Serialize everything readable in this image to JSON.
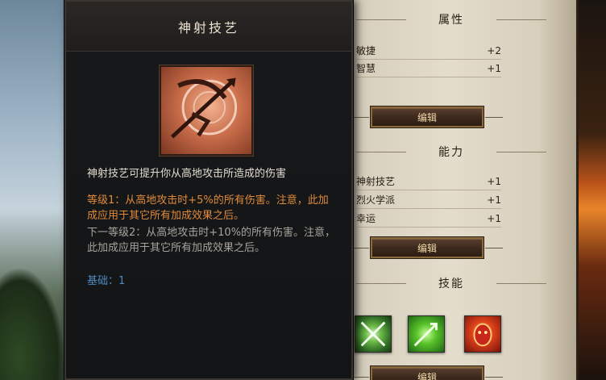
{
  "tooltip": {
    "title": "神射技艺",
    "icon": "archery-crossbow-icon",
    "description": "神射技艺可提升你从高地攻击所造成的伤害",
    "tier_current": "等级1：从高地攻击时+5%的所有伤害。注意，此加成应用于其它所有加成效果之后。",
    "tier_next": "下一等级2：从高地攻击时+10%的所有伤害。注意，此加成应用于其它所有加成效果之后。",
    "base": "基础：1",
    "colors": {
      "current_tier": "#e08a3a",
      "next_tier": "#a8a49c",
      "base": "#4f8ac0"
    }
  },
  "attributes": {
    "header": "属性",
    "rows": [
      {
        "name": "敏捷",
        "value": "+2"
      },
      {
        "name": "智慧",
        "value": "+1"
      }
    ],
    "edit_label": "编辑"
  },
  "abilities": {
    "header": "能力",
    "rows": [
      {
        "name": "神射技艺",
        "value": "+1"
      },
      {
        "name": "烈火学派",
        "value": "+1"
      },
      {
        "name": "幸运",
        "value": "+1"
      }
    ],
    "edit_label": "编辑"
  },
  "skills": {
    "header": "技能",
    "icons": [
      "leaf-blade-skill-icon",
      "green-arrow-skill-icon",
      "fire-mask-skill-icon"
    ],
    "edit_label": "编辑"
  }
}
